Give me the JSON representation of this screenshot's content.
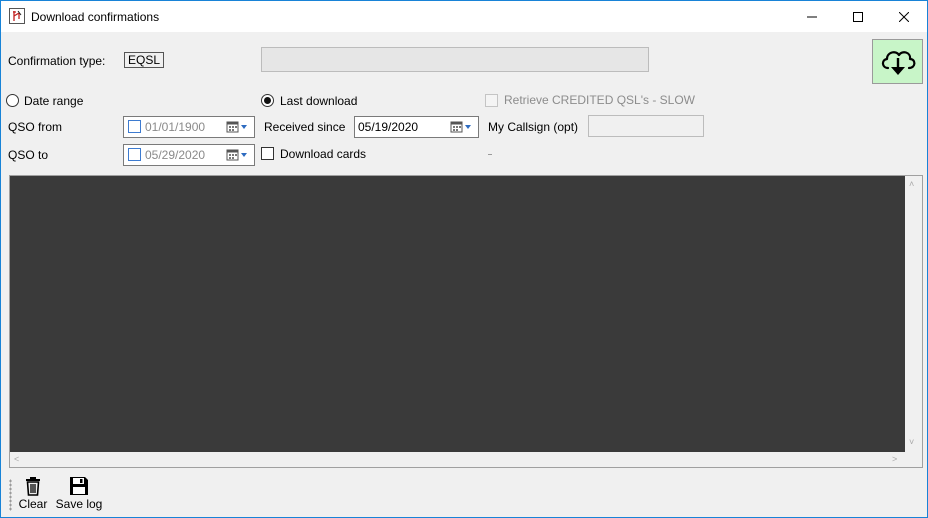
{
  "window": {
    "title": "Download confirmations",
    "controls": [
      "minimize-icon",
      "maximize-icon",
      "close-icon"
    ]
  },
  "confirmation": {
    "label": "Confirmation type:",
    "value": "EQSL"
  },
  "options": {
    "date_range_label": "Date range",
    "last_download_label": "Last download",
    "selected": "last_download",
    "retrieve_credited_label": "Retrieve CREDITED QSL's - SLOW",
    "retrieve_credited_checked": false,
    "retrieve_credited_enabled": false
  },
  "qso_from": {
    "label": "QSO from",
    "value": "01/01/1900",
    "checked": false
  },
  "qso_to": {
    "label": "QSO to",
    "value": "05/29/2020",
    "checked": false
  },
  "received_since": {
    "label": "Received since",
    "value": "05/19/2020"
  },
  "download_cards": {
    "label": "Download cards",
    "checked": false
  },
  "my_callsign": {
    "label": "My Callsign (opt)",
    "value": ""
  },
  "toolbar": {
    "clear_label": "Clear",
    "save_log_label": "Save log"
  },
  "colors": {
    "accent": "#0078d7",
    "download_button_bg": "#c8f5c8",
    "log_bg": "#3a3a3a"
  },
  "icons": {
    "app": "app-icon",
    "download": "cloud-download-icon",
    "calendar": "calendar-icon",
    "clear": "trash-icon",
    "save": "floppy-disk-icon"
  }
}
